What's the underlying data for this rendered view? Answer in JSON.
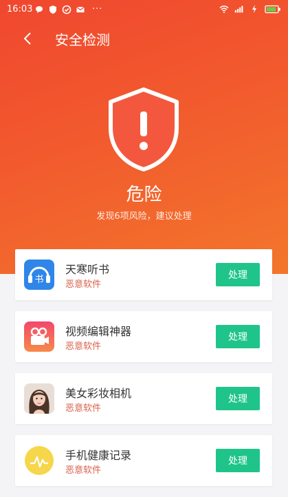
{
  "status_bar": {
    "time": "16:03",
    "more": "···"
  },
  "nav": {
    "title": "安全检测"
  },
  "result": {
    "level": "危险",
    "summary": "发现6项风险，建议处理"
  },
  "apps": [
    {
      "name": "天寒听书",
      "tag": "恶意软件",
      "action": "处理",
      "icon": "headphone-book-icon"
    },
    {
      "name": "视频编辑神器",
      "tag": "恶意软件",
      "action": "处理",
      "icon": "video-camera-icon"
    },
    {
      "name": "美女彩妆相机",
      "tag": "恶意软件",
      "action": "处理",
      "icon": "portrait-photo-icon"
    },
    {
      "name": "手机健康记录",
      "tag": "恶意软件",
      "action": "处理",
      "icon": "health-chart-icon"
    }
  ],
  "colors": {
    "hero_start": "#f0472f",
    "hero_end": "#f3762b",
    "action_green": "#1fc48b",
    "tag_red": "#d9614b"
  }
}
